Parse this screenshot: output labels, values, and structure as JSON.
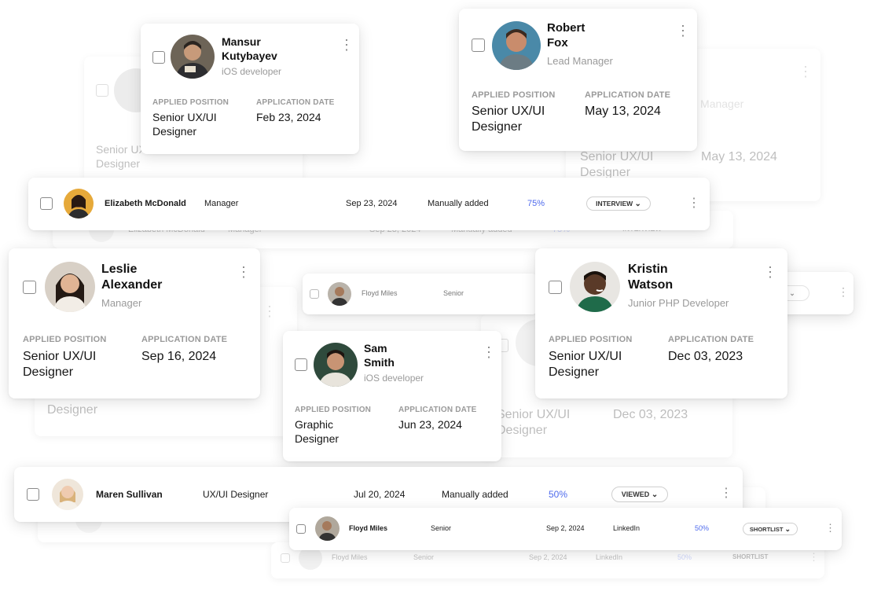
{
  "labels": {
    "applied_position": "APPLIED POSITION",
    "application_date": "APPLICATION DATE"
  },
  "cards": {
    "mansur": {
      "name_1": "Mansur",
      "name_2": "Kutybayev",
      "role": "iOS developer",
      "position_1": "Senior UX/UI",
      "position_2": "Designer",
      "date": "Feb 23, 2024"
    },
    "robert": {
      "name_1": "Robert",
      "name_2": "Fox",
      "role": "Lead Manager",
      "position_1": "Senior UX/UI",
      "position_2": "Designer",
      "date": "May 13, 2024"
    },
    "leslie": {
      "name_1": "Leslie",
      "name_2": "Alexander",
      "role": "Manager",
      "position_1": "Senior UX/UI",
      "position_2": "Designer",
      "date": "Sep 16, 2024"
    },
    "sam": {
      "name_1": "Sam",
      "name_2": "Smith",
      "role": "iOS developer",
      "position_1": "Graphic",
      "position_2": "Designer",
      "date": "Jun 23, 2024"
    },
    "kristin": {
      "name_1": "Kristin",
      "name_2": "Watson",
      "role": "Junior PHP Developer",
      "position_1": "Senior UX/UI",
      "position_2": "Designer",
      "date": "Dec 03, 2023"
    }
  },
  "ghost_cards": {
    "mansur": {
      "position_1": "Senior UX/UI",
      "position_2": "Designer"
    },
    "robert": {
      "role": "Lead Manager",
      "position_1": "Senior UX/UI",
      "position_2": "Designer",
      "date": "May 13, 2024"
    },
    "leslie": {
      "position_2": "Designer"
    },
    "kristin": {
      "position_1": "Senior UX/UI",
      "position_2": "Designer",
      "date": "Dec 03, 2023"
    }
  },
  "rows": {
    "elizabeth": {
      "name": "Elizabeth McDonald",
      "role": "Manager",
      "date": "Sep 23, 2024",
      "source": "Manually added",
      "match": "75%",
      "status": "INTERVIEW"
    },
    "maren": {
      "name": "Maren Sullivan",
      "role": "UX/UI Designer",
      "date": "Jul 20, 2024",
      "source": "Manually added",
      "match": "50%",
      "status": "VIEWED"
    },
    "floyd_small": {
      "name": "Floyd Miles",
      "role": "Senior"
    },
    "floyd": {
      "name": "Floyd Miles",
      "role": "Senior",
      "date": "Sep 2, 2024",
      "source": "LinkedIn",
      "match": "50%",
      "status": "SHORTLIST"
    }
  },
  "ghost_rows": {
    "elizabeth": {
      "name": "Elizabeth McDonald",
      "role": "Manager",
      "date": "Sep 23, 2024",
      "source": "Manually added",
      "match": "75%",
      "status": "INTERVIEW"
    },
    "floyd": {
      "name": "Floyd Miles",
      "role": "Senior",
      "date": "Sep 2, 2024",
      "source": "LinkedIn",
      "match": "50%",
      "status": "SHORTLIST"
    }
  },
  "icons": {
    "checkbox": "checkbox-icon",
    "more": "kebab-menu-icon",
    "dropdown": "chevron-down-icon",
    "avatar": "avatar-photo"
  },
  "colors": {
    "match_percent": "#4f6bed",
    "muted_text": "#9a9a9a",
    "card_bg": "#ffffff"
  }
}
